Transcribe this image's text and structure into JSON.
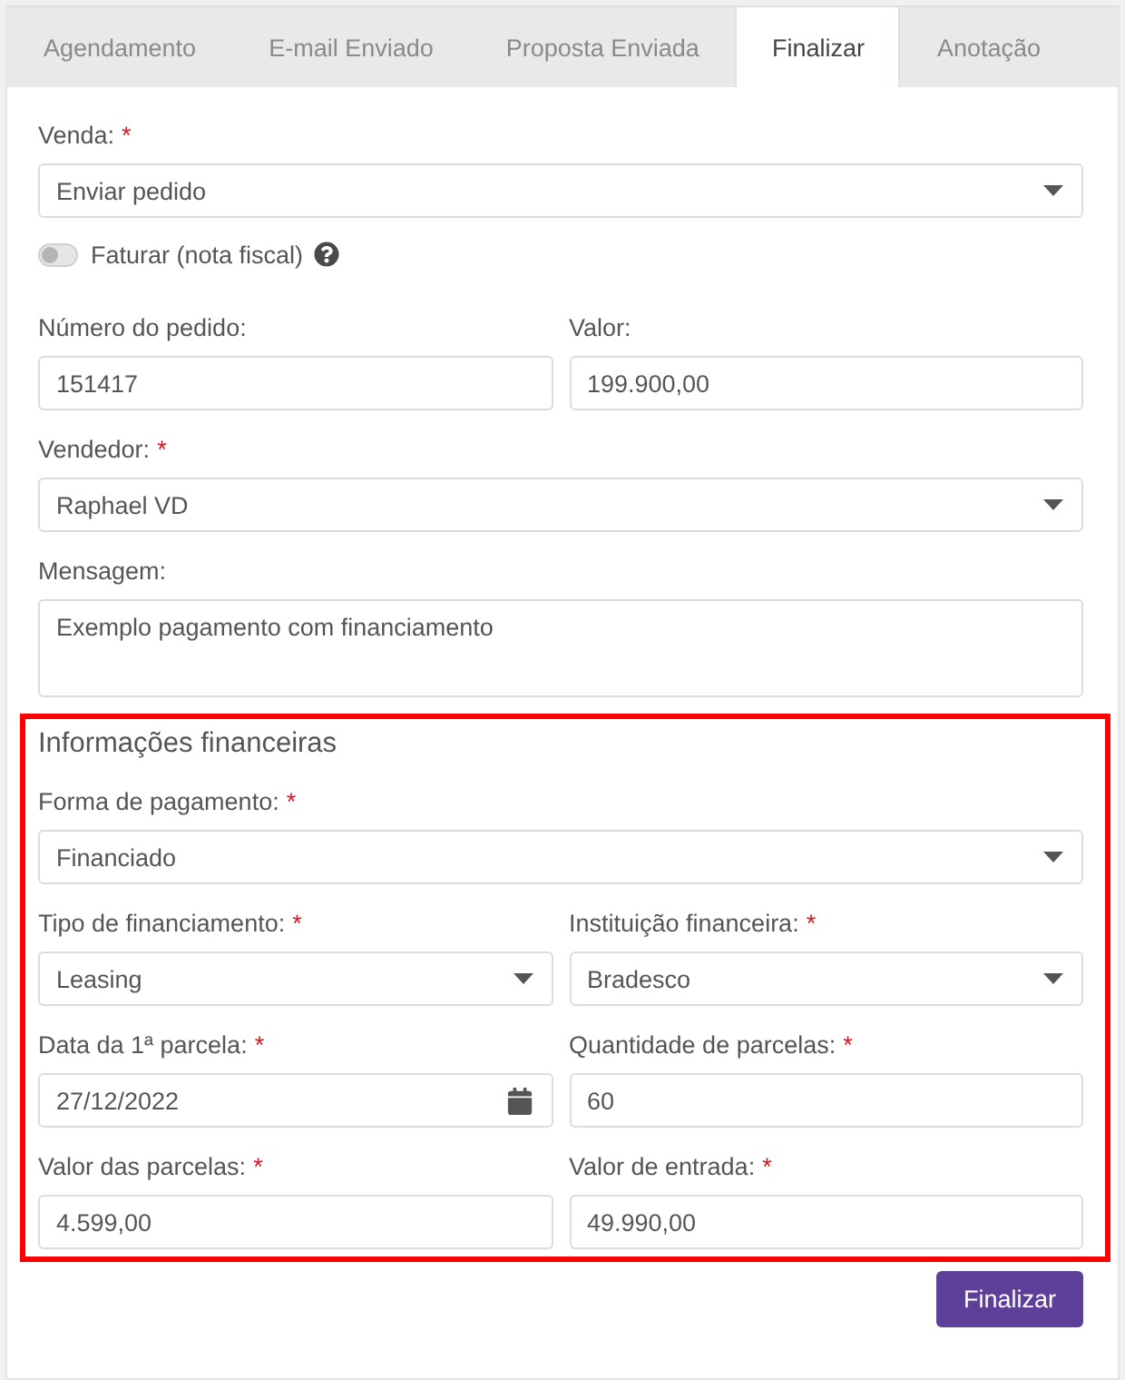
{
  "tabs": [
    {
      "label": "Agendamento",
      "selected": false
    },
    {
      "label": "E-mail Enviado",
      "selected": false
    },
    {
      "label": "Proposta Enviada",
      "selected": false
    },
    {
      "label": "Finalizar",
      "selected": true
    },
    {
      "label": "Anotação",
      "selected": false
    }
  ],
  "rows": [
    {
      "fields": [
        {
          "kind": "select",
          "label": "Venda:",
          "required_mark": "*",
          "value": "Enviar pedido"
        }
      ]
    },
    {
      "fields": [
        {
          "kind": "toggle",
          "label": "Faturar (nota fiscal)",
          "on": false,
          "help": true
        }
      ]
    },
    {
      "fields": [
        {
          "kind": "input",
          "label": "Número do pedido:",
          "value": "151417"
        },
        {
          "kind": "input",
          "label": "Valor:",
          "value": "199.900,00"
        }
      ]
    },
    {
      "fields": [
        {
          "kind": "select",
          "label": "Vendedor:",
          "required_mark": "*",
          "value": "Raphael VD"
        }
      ]
    },
    {
      "fields": [
        {
          "kind": "textarea",
          "label": "Mensagem:",
          "value": "Exemplo pagamento com financiamento"
        }
      ]
    }
  ],
  "financial_section": {
    "title": "Informações financeiras",
    "highlighted": true,
    "rows": [
      {
        "fields": [
          {
            "kind": "select",
            "label": "Forma de pagamento:",
            "required_mark": "*",
            "value": "Financiado"
          }
        ]
      },
      {
        "fields": [
          {
            "kind": "select",
            "label": "Tipo de financiamento:",
            "required_mark": "*",
            "value": "Leasing"
          },
          {
            "kind": "select",
            "label": "Instituição financeira:",
            "required_mark": "*",
            "value": "Bradesco"
          }
        ]
      },
      {
        "fields": [
          {
            "kind": "date",
            "label": "Data da 1ª parcela:",
            "required_mark": "*",
            "value": "27/12/2022"
          },
          {
            "kind": "input",
            "label": "Quantidade de parcelas:",
            "required_mark": "*",
            "value": "60"
          }
        ]
      },
      {
        "fields": [
          {
            "kind": "input",
            "label": "Valor das parcelas:",
            "required_mark": "*",
            "value": "4.599,00"
          },
          {
            "kind": "input",
            "label": "Valor de entrada:",
            "required_mark": "*",
            "value": "49.990,00"
          }
        ]
      }
    ]
  },
  "submit_button": {
    "label": "Finalizar"
  }
}
